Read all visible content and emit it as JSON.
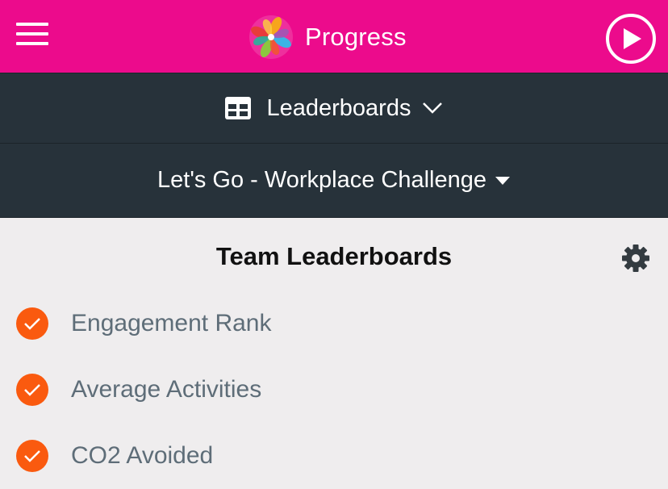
{
  "header": {
    "title": "Progress",
    "menu_icon": "hamburger-menu-icon",
    "logo_icon": "pinwheel-logo-icon",
    "play_icon": "play-circle-icon",
    "background": "#ec0b8c"
  },
  "nav": {
    "section_label": "Leaderboards",
    "section_icon": "grid-table-icon",
    "challenge_label": "Let's Go - Workplace Challenge",
    "background": "#27323a"
  },
  "main": {
    "title": "Team Leaderboards",
    "settings_icon": "gear-icon",
    "options": [
      {
        "label": "Engagement Rank",
        "checked": true
      },
      {
        "label": "Average Activities",
        "checked": true
      },
      {
        "label": "CO2 Avoided",
        "checked": true
      }
    ],
    "check_color": "#fa5a0f"
  }
}
